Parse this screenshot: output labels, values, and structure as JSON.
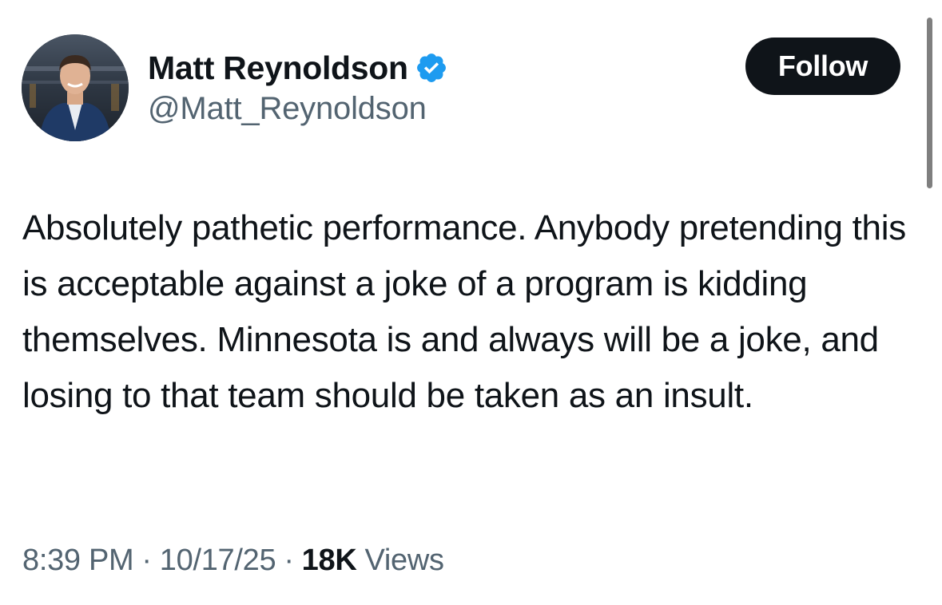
{
  "tweet": {
    "author": {
      "display_name": "Matt Reynoldson",
      "handle": "@Matt_Reynoldson",
      "verified": true
    },
    "follow_label": "Follow",
    "text": "Absolutely pathetic performance. Anybody pretending this is acceptable against a joke of a program is kidding themselves. Minnesota is and always will be a joke, and losing to that team should be taken as an insult.",
    "time": "8:39 PM",
    "date": "10/17/25",
    "views_count": "18K",
    "views_label": "Views",
    "separator": "·"
  },
  "icons": {
    "verified": "verified-badge-icon",
    "avatar": "profile-photo"
  },
  "colors": {
    "verified_blue": "#1d9bf0",
    "follow_bg": "#0f1419",
    "secondary_text": "#536471",
    "primary_text": "#0f1419"
  }
}
